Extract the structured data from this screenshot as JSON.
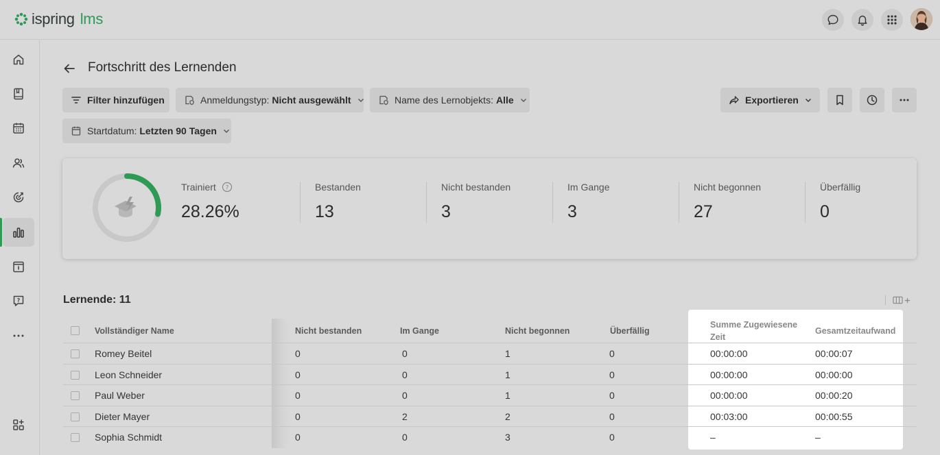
{
  "app": {
    "logo_word1": "ispring",
    "logo_word2": "lms",
    "brand_color": "#2e9a55"
  },
  "topbar": {
    "icons": [
      "chat-icon",
      "bell-icon",
      "apps-grid-icon",
      "avatar"
    ]
  },
  "sidebar": {
    "items": [
      "home-icon",
      "book-icon",
      "calendar-icon",
      "users-icon",
      "target-icon",
      "reports-icon",
      "info-calendar-icon",
      "help-icon",
      "more-icon"
    ],
    "active": "reports-icon",
    "bottom_item": "add-widget-icon"
  },
  "page": {
    "title": "Fortschritt des Lernenden"
  },
  "filters": {
    "add_filter": "Filter hinzufügen",
    "registration_label": "Anmeldungstyp:",
    "registration_value": "Nicht ausgewählt",
    "object_label": "Name des Lernobjekts:",
    "object_value": "Alle",
    "start_label": "Startdatum:",
    "start_value": "Letzten 90 Tagen"
  },
  "actions": {
    "export": "Exportieren"
  },
  "stats": {
    "trained_label": "Trainiert",
    "trained_value": "28.26%",
    "trained_fraction": 0.2826,
    "passed_label": "Bestanden",
    "passed_value": "13",
    "failed_label": "Nicht bestanden",
    "failed_value": "3",
    "in_progress_label": "Im Gange",
    "in_progress_value": "3",
    "not_started_label": "Nicht begonnen",
    "not_started_value": "27",
    "overdue_label": "Überfällig",
    "overdue_value": "0"
  },
  "table": {
    "learners_label": "Lernende: 11",
    "headers": {
      "name": "Vollständiger Name",
      "failed": "Nicht bestanden",
      "in_progress": "Im Gange",
      "not_started": "Nicht begonnen",
      "overdue": "Überfällig",
      "assigned_time_1": "Summe Zugewiesene",
      "assigned_time_2": "Zeit",
      "total_time": "Gesamtzeitaufwand"
    },
    "rows": [
      {
        "name": "Romey Beitel",
        "failed": "0",
        "in_progress": "0",
        "not_started": "1",
        "overdue": "0",
        "assigned": "00:00:00",
        "total": "00:00:07"
      },
      {
        "name": "Leon Schneider",
        "failed": "0",
        "in_progress": "0",
        "not_started": "1",
        "overdue": "0",
        "assigned": "00:00:00",
        "total": "00:00:00"
      },
      {
        "name": "Paul Weber",
        "failed": "0",
        "in_progress": "0",
        "not_started": "1",
        "overdue": "0",
        "assigned": "00:00:00",
        "total": "00:00:20"
      },
      {
        "name": "Dieter Mayer",
        "failed": "0",
        "in_progress": "2",
        "not_started": "2",
        "overdue": "0",
        "assigned": "00:03:00",
        "total": "00:00:55"
      },
      {
        "name": "Sophia Schmidt",
        "failed": "0",
        "in_progress": "0",
        "not_started": "3",
        "overdue": "0",
        "assigned": "–",
        "total": "–"
      }
    ]
  }
}
